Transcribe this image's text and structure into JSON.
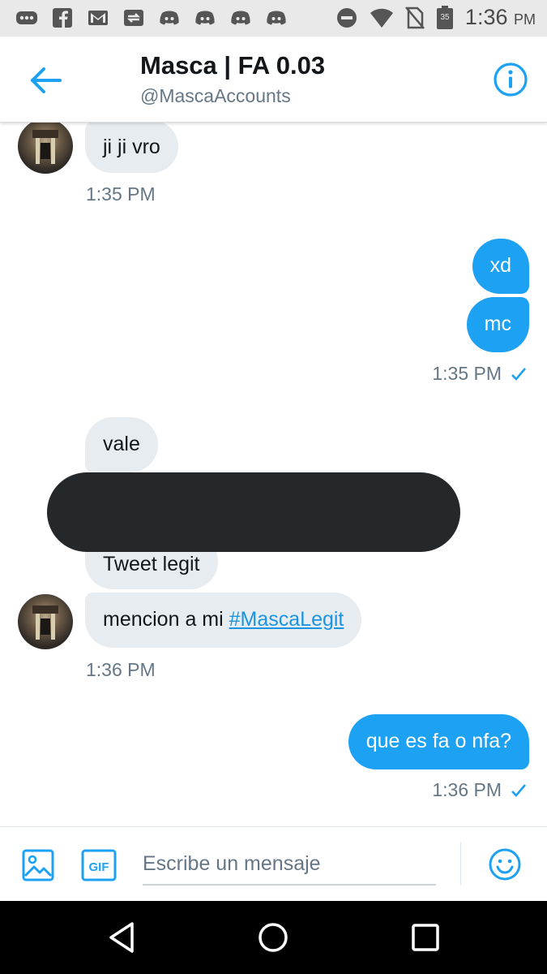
{
  "status_bar": {
    "time": "1:36",
    "ampm": "PM",
    "battery_level": "35",
    "left_icons": [
      "more-icon",
      "facebook-icon",
      "gmail-icon",
      "sync-icon",
      "discord-icon",
      "discord-icon",
      "discord-icon",
      "discord-icon"
    ],
    "right_icons": [
      "do-not-disturb-icon",
      "wifi-icon",
      "no-sim-icon",
      "battery-icon"
    ]
  },
  "header": {
    "title": "Masca | FA 0.03",
    "handle": "@MascaAccounts",
    "back_icon": "arrow-left-icon",
    "info_icon": "info-icon",
    "accent": "#1da1f2"
  },
  "messages": {
    "m1": {
      "text": "ji ji vro",
      "direction": "incoming"
    },
    "ts1": "1:35 PM",
    "m2": {
      "text": "xd",
      "direction": "outgoing"
    },
    "m3": {
      "text": "mc",
      "direction": "outgoing"
    },
    "ts2": "1:35 PM",
    "m4": {
      "text": "vale",
      "direction": "incoming"
    },
    "m5": {
      "text": "Tweet legit",
      "direction": "incoming"
    },
    "m6": {
      "text": "mencion a mi ",
      "hashtag": "#MascaLegit",
      "direction": "incoming"
    },
    "ts3": "1:36 PM",
    "m7": {
      "text": "que es fa o nfa?",
      "direction": "outgoing"
    },
    "ts4": "1:36 PM"
  },
  "composer": {
    "placeholder": "Escribe un mensaje",
    "gif_label": "GIF",
    "image_icon": "image-icon",
    "emoji_icon": "emoji-icon"
  },
  "nav_bar": {
    "icons": [
      "nav-back-icon",
      "nav-home-icon",
      "nav-recents-icon"
    ]
  },
  "colors": {
    "outgoing_bubble": "#1da1f2",
    "incoming_bubble": "#e6ecf0",
    "secondary_text": "#657786",
    "redaction": "#25282b"
  }
}
